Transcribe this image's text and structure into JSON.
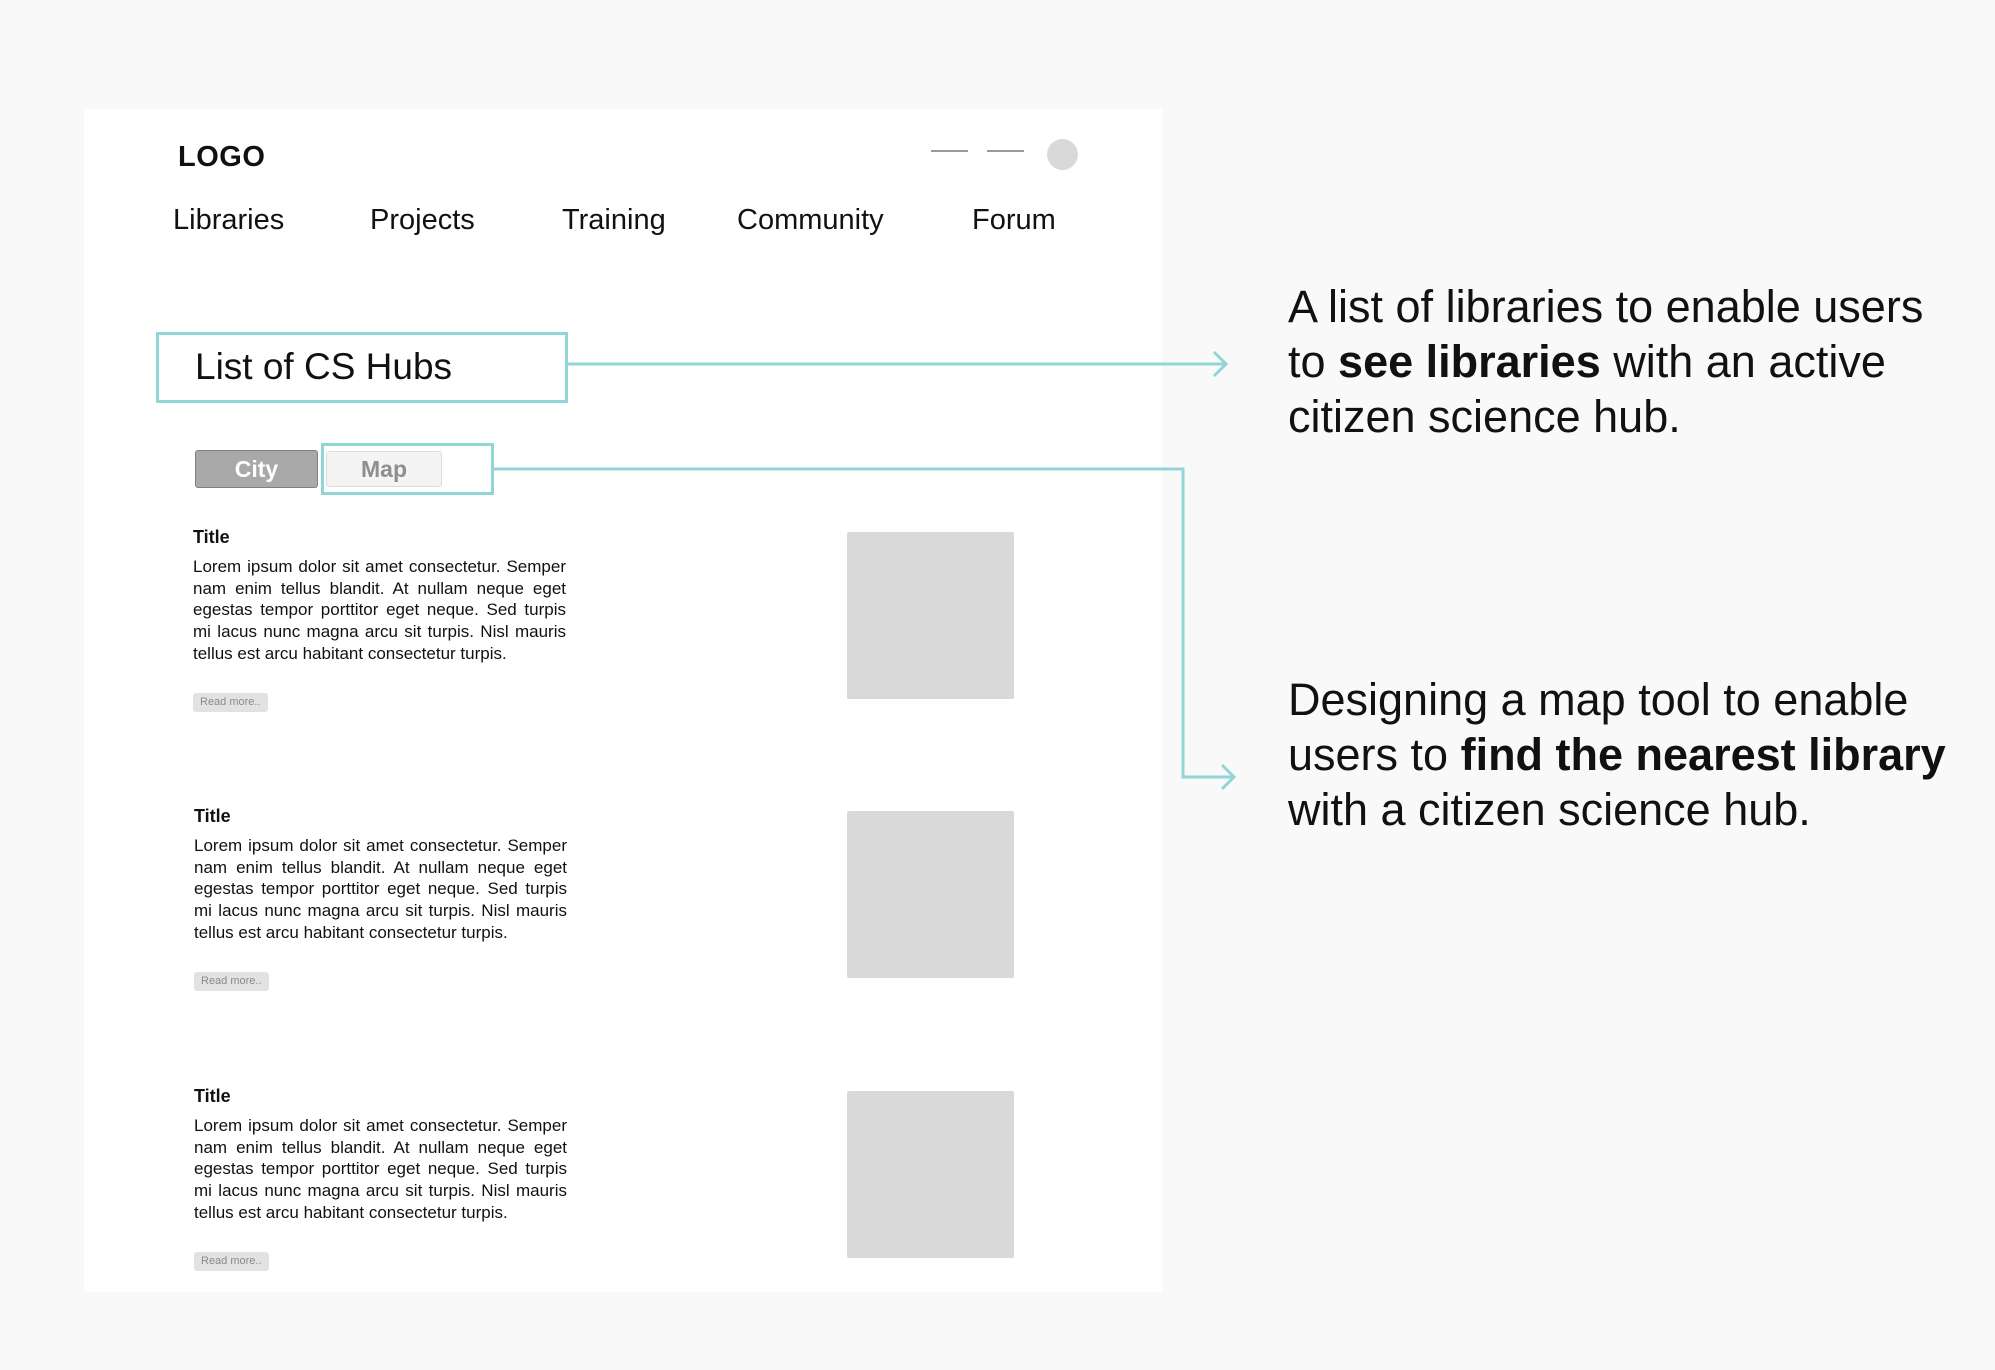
{
  "header": {
    "logo": "LOGO",
    "nav": [
      "Libraries",
      "Projects",
      "Training",
      "Community",
      "Forum"
    ]
  },
  "hub_list_title": "List of CS Hubs",
  "toggle": {
    "city": "City",
    "map": "Map"
  },
  "cards": [
    {
      "title": "Title",
      "text": "Lorem ipsum dolor sit amet consectetur. Semper nam enim tellus blandit. At nullam neque eget egestas tempor porttitor eget neque. Sed turpis mi lacus nunc magna arcu sit turpis. Nisl mauris tellus est arcu habitant consectetur turpis.",
      "read_more": "Read more.."
    },
    {
      "title": "Title",
      "text": "Lorem ipsum dolor sit amet consectetur. Semper nam enim tellus blandit. At nullam neque eget egestas tempor porttitor eget neque. Sed turpis mi lacus nunc magna arcu sit turpis. Nisl mauris tellus est arcu habitant consectetur turpis.",
      "read_more": "Read more.."
    },
    {
      "title": "Title",
      "text": "Lorem ipsum dolor sit amet consectetur. Semper nam enim tellus blandit. At nullam neque eget egestas tempor porttitor eget neque. Sed turpis mi lacus nunc magna arcu sit turpis. Nisl mauris tellus est arcu habitant consectetur turpis.",
      "read_more": "Read more.."
    }
  ],
  "annotations": {
    "first": {
      "before": "A list of libraries to enable users to ",
      "bold": "see libraries",
      "after": " with an active citizen science hub."
    },
    "second": {
      "before": "Designing a map tool to enable users to ",
      "bold": "find the nearest library",
      "after": " with a citizen science hub."
    }
  },
  "colors": {
    "accent": "#91d5d7",
    "placeholder": "#d9d9d9",
    "background": "#f9f9f9"
  }
}
